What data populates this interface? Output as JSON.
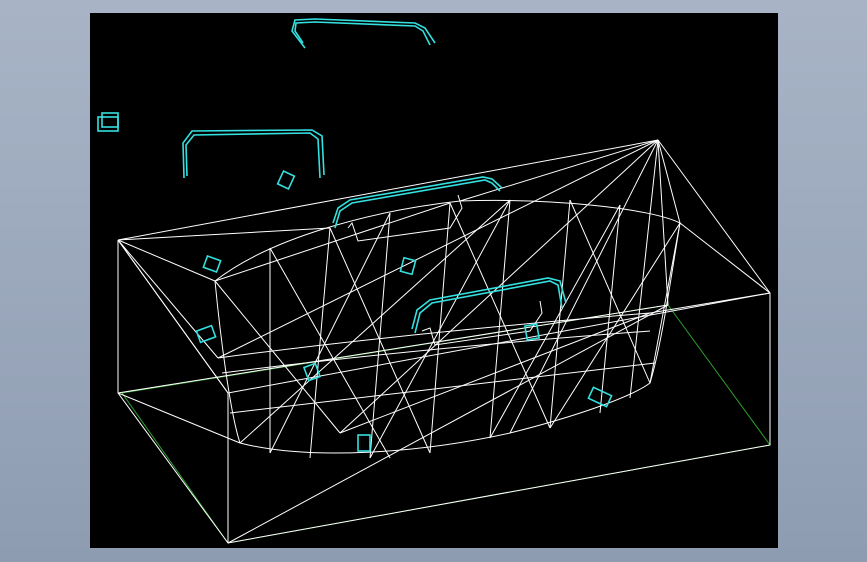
{
  "viewport": {
    "background_color": "#000000",
    "desktop_background": "#9aa7ba"
  },
  "model": {
    "view": "3D wireframe",
    "body_color": "#ffffff",
    "handle_color": "#34e0e0",
    "bounding_box_color": "#2aa02a"
  },
  "icons": [
    "handle-icon",
    "clip-icon"
  ]
}
